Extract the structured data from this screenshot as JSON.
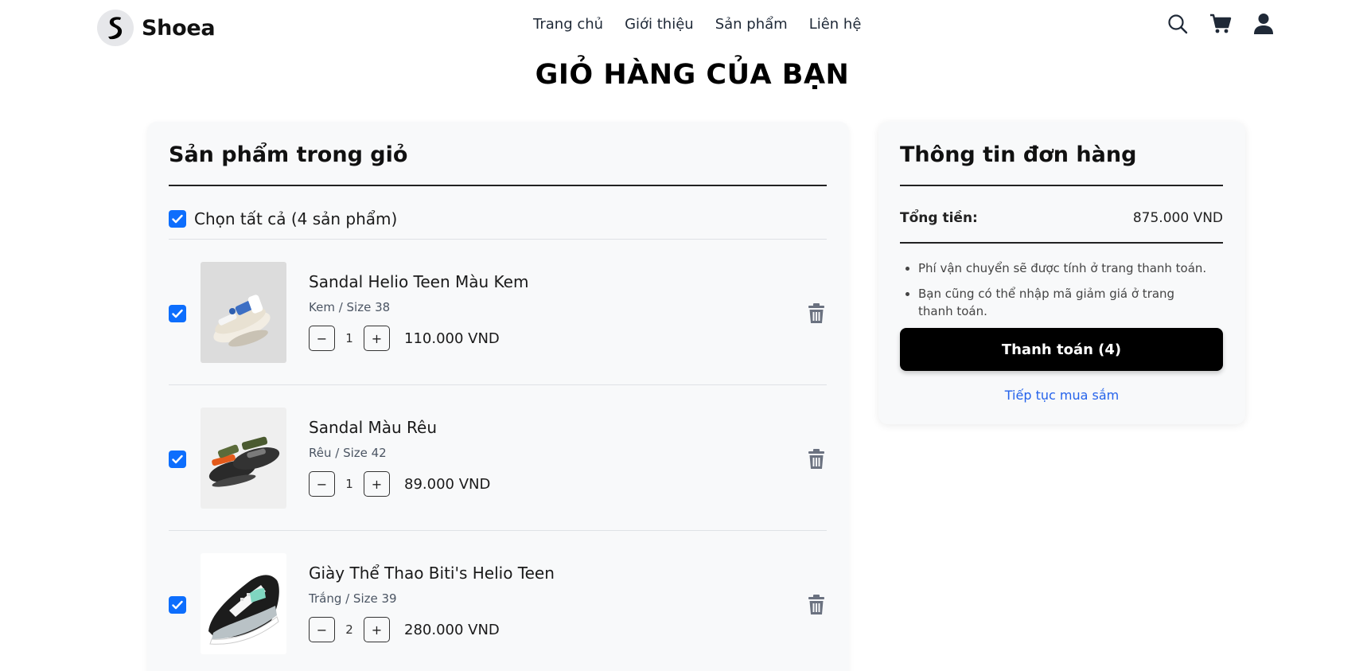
{
  "brand": {
    "name": "Shoea"
  },
  "nav": {
    "items": [
      {
        "label": "Trang chủ"
      },
      {
        "label": "Giới thiệu"
      },
      {
        "label": "Sản phẩm"
      },
      {
        "label": "Liên hệ"
      }
    ]
  },
  "header_icons": [
    "search-icon",
    "cart-icon",
    "user-icon"
  ],
  "page_title": "GIỎ HÀNG CỦA BẠN",
  "cart": {
    "title": "Sản phẩm trong giỏ",
    "select_all": {
      "label": "Chọn tất cả (4 sản phẩm)",
      "checked": true
    },
    "items": [
      {
        "name": "Sandal Helio Teen Màu Kem",
        "variant": "Kem / Size 38",
        "quantity": "1",
        "price": "110.000 VND",
        "checked": true
      },
      {
        "name": "Sandal Màu Rêu",
        "variant": "Rêu / Size 42",
        "quantity": "1",
        "price": "89.000 VND",
        "checked": true
      },
      {
        "name": "Giày Thể Thao Biti's Helio Teen",
        "variant": "Trắng / Size 39",
        "quantity": "2",
        "price": "280.000 VND",
        "checked": true
      }
    ],
    "qty_minus": "−",
    "qty_plus": "+"
  },
  "summary": {
    "title": "Thông tin đơn hàng",
    "total_label": "Tổng tiền:",
    "total_value": "875.000 VND",
    "notes": [
      "Phí vận chuyển sẽ được tính ở trang thanh toán.",
      "Bạn cũng có thể nhập mã giảm giá ở trang thanh toán."
    ],
    "checkout_label": "Thanh toán (4)",
    "continue_label": "Tiếp tục mua sắm"
  },
  "colors": {
    "accent": "#0d6efd",
    "link": "#2563eb",
    "button": "#000000",
    "panel": "#f8f9fa"
  }
}
